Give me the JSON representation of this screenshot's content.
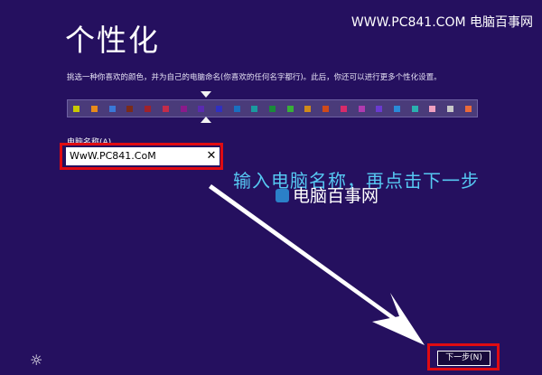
{
  "header": {
    "title": "个性化",
    "watermark": "WWW.PC841.COM 电脑百事网"
  },
  "description": "挑选一种你喜欢的颜色，并为自己的电脑命名(你喜欢的任何名字都行)。此后，你还可以进行更多个性化设置。",
  "palette": {
    "swatches": [
      "#c9c900",
      "#e88a1a",
      "#3a78d8",
      "#7a2b1a",
      "#a0222c",
      "#c42c4a",
      "#8b1a8b",
      "#5a2bb0",
      "#3030c0",
      "#1a6fc0",
      "#1a9aa0",
      "#1a8a3a",
      "#38b038",
      "#d08a1a",
      "#d04a1a",
      "#d82a6a",
      "#b03ab0",
      "#6a3ad0",
      "#2a8ad8",
      "#2ab0b0",
      "#f0a0c0",
      "#c8c8c8",
      "#ea6a3a"
    ],
    "selected_index": 7
  },
  "computer_name": {
    "label": "电脑名称(A)",
    "value": "WwW.PC841.CoM",
    "clear_icon": "✕"
  },
  "annotation": {
    "instruction": "输入电脑名称，再点击下一步",
    "logo_text": "电脑百事网"
  },
  "footer": {
    "accessibility_icon": "☼",
    "next_label": "下一步(N)"
  },
  "colors": {
    "background": "#25105f",
    "highlight": "#e00b12",
    "annotation_text": "#56c8f2"
  }
}
